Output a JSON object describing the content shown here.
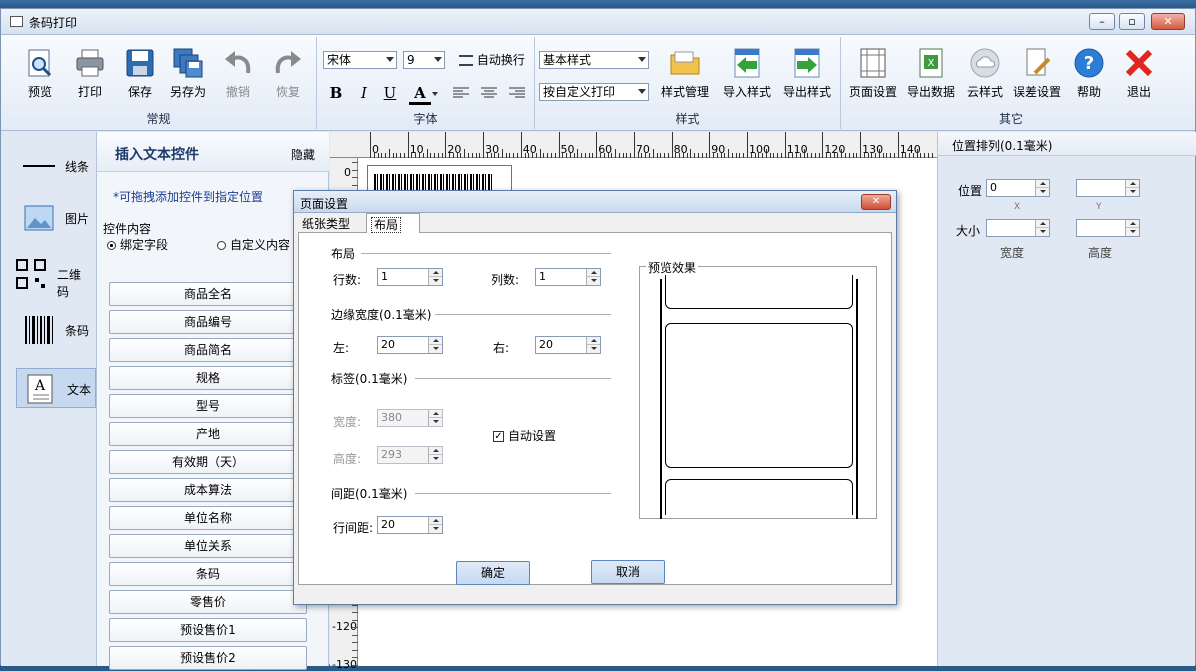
{
  "window": {
    "title": "条码打印"
  },
  "ribbon": {
    "groups": {
      "general": "常规",
      "font": "字体",
      "style": "样式",
      "other": "其它"
    },
    "general": {
      "preview": "预览",
      "print": "打印",
      "save": "保存",
      "save_as": "另存为",
      "undo": "撤销",
      "redo": "恢复"
    },
    "font": {
      "family": "宋体",
      "size": "9",
      "wrap": "自动换行",
      "bold": "B",
      "italic": "I",
      "underline": "U",
      "color": "A"
    },
    "style": {
      "basic_style": "基本样式",
      "print_mode": "按自定义打印",
      "manage": "样式管理",
      "import": "导入样式",
      "export": "导出样式"
    },
    "other": {
      "page_setup": "页面设置",
      "export_data": "导出数据",
      "cloud_style": "云样式",
      "error_setup": "误差设置",
      "help": "帮助",
      "exit": "退出"
    }
  },
  "toolbox": {
    "line": "线条",
    "image": "图片",
    "qrcode": "二维码",
    "barcode": "条码",
    "text": "文本"
  },
  "panel": {
    "title": "插入文本控件",
    "hide": "隐藏",
    "hint": "*可拖拽添加控件到指定位置",
    "content_group": "控件内容",
    "radio_bind": "绑定字段",
    "radio_custom": "自定义内容",
    "fields": [
      "商品全名",
      "商品编号",
      "商品简名",
      "规格",
      "型号",
      "产地",
      "有效期（天）",
      "成本算法",
      "单位名称",
      "单位关系",
      "条码",
      "零售价",
      "预设售价1",
      "预设售价2"
    ]
  },
  "ruler": {
    "h_labels": [
      "0",
      "10",
      "20",
      "30",
      "40",
      "50",
      "60",
      "70",
      "80",
      "90",
      "100",
      "110",
      "120",
      "130",
      "140"
    ],
    "v_labels": [
      "0",
      "-120",
      "-130"
    ]
  },
  "right_panel": {
    "title": "位置排列(0.1毫米)",
    "position_label": "位置",
    "size_label": "大小",
    "x_value": "0",
    "x_caption": "X",
    "y_caption": "Y",
    "width_caption": "宽度",
    "height_caption": "高度"
  },
  "dialog": {
    "title": "页面设置",
    "tabs": [
      "纸张类型",
      "布局"
    ],
    "layout_section": "布局",
    "rows_label": "行数:",
    "rows_value": "1",
    "cols_label": "列数:",
    "cols_value": "1",
    "margin_section": "边缘宽度(0.1毫米)",
    "left_label": "左:",
    "left_value": "20",
    "right_label": "右:",
    "right_value": "20",
    "label_section": "标签(0.1毫米)",
    "width_label": "宽度:",
    "width_value": "380",
    "height_label": "高度:",
    "height_value": "293",
    "auto_setting": "自动设置",
    "spacing_section": "间距(0.1毫米)",
    "row_spacing_label": "行间距:",
    "row_spacing_value": "20",
    "preview_label": "预览效果",
    "ok": "确定",
    "cancel": "取消"
  }
}
